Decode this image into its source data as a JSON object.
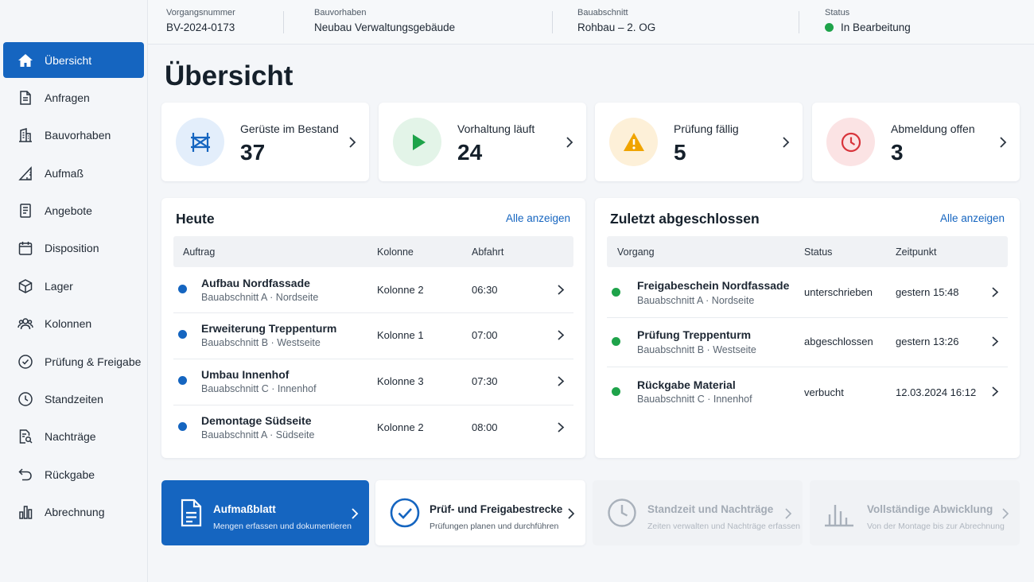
{
  "header": {
    "fields": [
      {
        "label": "Vorgangsnummer",
        "value": "BV-2024-0173"
      },
      {
        "label": "Bauvorhaben",
        "value": "Neubau Verwaltungsgebäude"
      },
      {
        "label": "Bauabschnitt",
        "value": "Rohbau – 2. OG"
      },
      {
        "label": "Status",
        "value": "In Bearbeitung"
      }
    ],
    "status_color": "#1ea34a"
  },
  "sidebar": {
    "items": [
      {
        "label": "Übersicht",
        "icon": "home-icon",
        "active": true
      },
      {
        "label": "Anfragen",
        "icon": "document-icon"
      },
      {
        "label": "Bauvorhaben",
        "icon": "building-icon"
      },
      {
        "label": "Aufmaß",
        "icon": "ruler-triangle-icon"
      },
      {
        "label": "Angebote",
        "icon": "list-document-icon"
      },
      {
        "label": "Disposition",
        "icon": "calendar-icon"
      },
      {
        "label": "Lager",
        "icon": "box-icon"
      },
      {
        "label": "Kolonnen",
        "icon": "team-icon"
      },
      {
        "label": "Prüfung & Freigabe",
        "icon": "check-circle-icon"
      },
      {
        "label": "Standzeiten",
        "icon": "clock-icon"
      },
      {
        "label": "Nachträge",
        "icon": "document-search-icon"
      },
      {
        "label": "Rückgabe",
        "icon": "return-arrow-icon"
      },
      {
        "label": "Abrechnung",
        "icon": "bar-chart-icon"
      }
    ]
  },
  "page_title": "Übersicht",
  "kpis": [
    {
      "label": "Gerüste im Bestand",
      "value": "37",
      "icon": "scaffold-icon",
      "color": "#1565c0",
      "bg": "#e3eefb"
    },
    {
      "label": "Vorhaltung läuft",
      "value": "24",
      "icon": "play-icon",
      "color": "#1ea34a",
      "bg": "#e3f4e8"
    },
    {
      "label": "Prüfung fällig",
      "value": "5",
      "icon": "warning-icon",
      "color": "#f0a400",
      "bg": "#fdf0d8"
    },
    {
      "label": "Abmeldung offen",
      "value": "3",
      "icon": "alarm-clock-icon",
      "color": "#d8343b",
      "bg": "#fbe3e4"
    }
  ],
  "today": {
    "title": "Heute",
    "link": "Alle anzeigen",
    "columns": [
      "Auftrag",
      "Kolonne",
      "Abfahrt"
    ],
    "rows": [
      {
        "title": "Aufbau Nordfassade",
        "sub": "Bauabschnitt A · Nordseite",
        "kolonne": "Kolonne 2",
        "time": "06:30"
      },
      {
        "title": "Erweiterung Treppenturm",
        "sub": "Bauabschnitt B · Westseite",
        "kolonne": "Kolonne 1",
        "time": "07:00"
      },
      {
        "title": "Umbau Innenhof",
        "sub": "Bauabschnitt C · Innenhof",
        "kolonne": "Kolonne 3",
        "time": "07:30"
      },
      {
        "title": "Demontage Südseite",
        "sub": "Bauabschnitt A · Südseite",
        "kolonne": "Kolonne 2",
        "time": "08:00"
      }
    ],
    "dot_color": "#1565c0"
  },
  "recent": {
    "title": "Zuletzt abgeschlossen",
    "link": "Alle anzeigen",
    "columns": [
      "Vorgang",
      "Status",
      "Zeitpunkt"
    ],
    "rows": [
      {
        "title": "Freigabeschein Nordfassade",
        "sub": "Bauabschnitt A · Nordseite",
        "status": "unterschrieben",
        "time": "gestern 15:48"
      },
      {
        "title": "Prüfung Treppenturm",
        "sub": "Bauabschnitt B · Westseite",
        "status": "abgeschlossen",
        "time": "gestern 13:26"
      },
      {
        "title": "Rückgabe Material",
        "sub": "Bauabschnitt C · Innenhof",
        "status": "verbucht",
        "time": "12.03.2024 16:12"
      }
    ],
    "dot_color": "#1ea34a"
  },
  "actions": [
    {
      "title": "Aufmaßblatt",
      "sub": "Mengen erfassen und dokumentieren",
      "icon": "document-icon",
      "state": "primary"
    },
    {
      "title": "Prüf- und Freigabestrecke",
      "sub": "Prüfungen planen und durchführen",
      "icon": "check-circle-icon",
      "state": "normal"
    },
    {
      "title": "Standzeit und Nachträge",
      "sub": "Zeiten verwalten und Nachträge erfassen",
      "icon": "clock-icon",
      "state": "disabled"
    },
    {
      "title": "Vollständige Abwicklung",
      "sub": "Von der Montage bis zur Abrechnung",
      "icon": "bar-chart-icon",
      "state": "disabled"
    }
  ]
}
